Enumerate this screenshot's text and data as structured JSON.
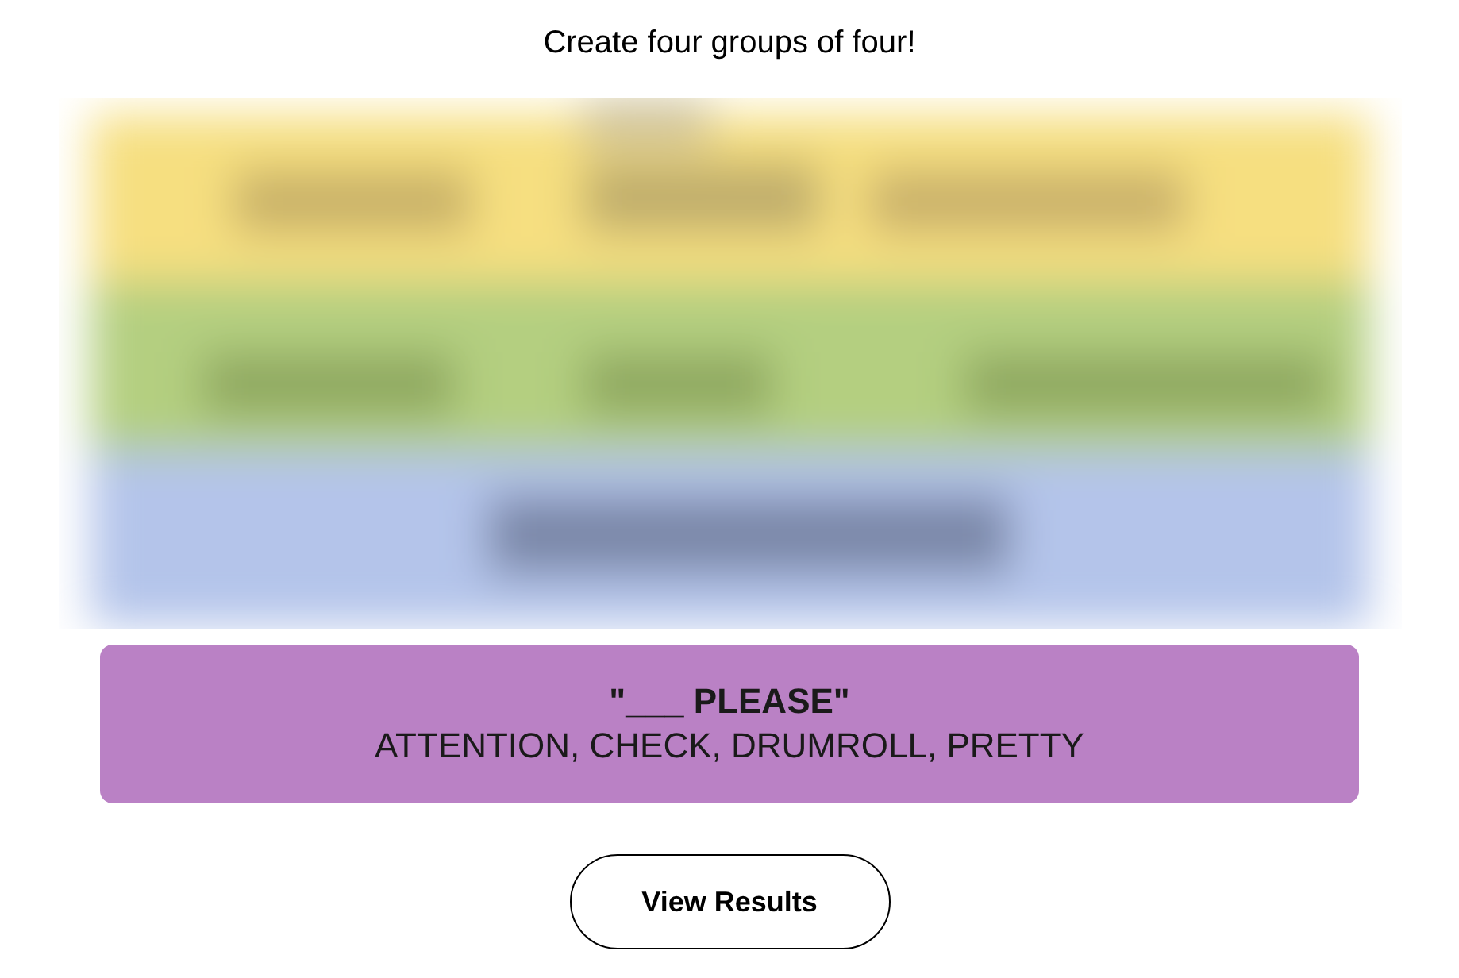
{
  "instruction": "Create four groups of four!",
  "solved_groups": [
    {
      "title": "\"___ PLEASE\"",
      "members": "ATTENTION, CHECK, DRUMROLL, PRETTY",
      "color": "#ba81c5"
    }
  ],
  "button": {
    "label": "View Results"
  }
}
